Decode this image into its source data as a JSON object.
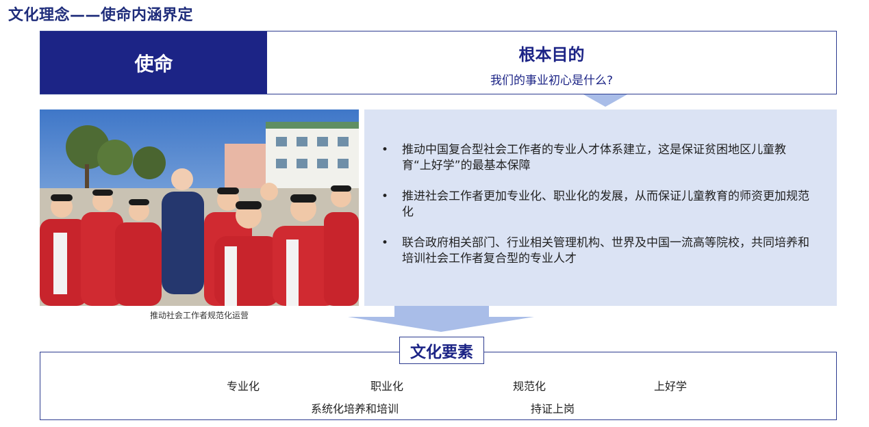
{
  "page_title": "文化理念——使命内涵界定",
  "header": {
    "mission_label": "使命",
    "purpose_title": "根本目的",
    "purpose_question": "我们的事业初心是什么?"
  },
  "photo_caption": "推动社会工作者规范化运营",
  "bullets": [
    "推动中国复合型社会工作者的专业人才体系建立，这是保证贫困地区儿童教育“上好学”的最基本保障",
    "推进社会工作者更加专业化、职业化的发展，从而保证儿童教育的师资更加规范化",
    "联合政府相关部门、行业相关管理机构、世界及中国一流高等院校，共同培养和培训社会工作者复合型的专业人才"
  ],
  "elements": {
    "label": "文化要素",
    "items": [
      "专业化",
      "职业化",
      "规范化",
      "上好学",
      "系统化培养和培训",
      "持证上岗"
    ]
  },
  "colors": {
    "navy": "#1c2486",
    "panel": "#dbe3f4",
    "arrow": "#a9bde8"
  }
}
